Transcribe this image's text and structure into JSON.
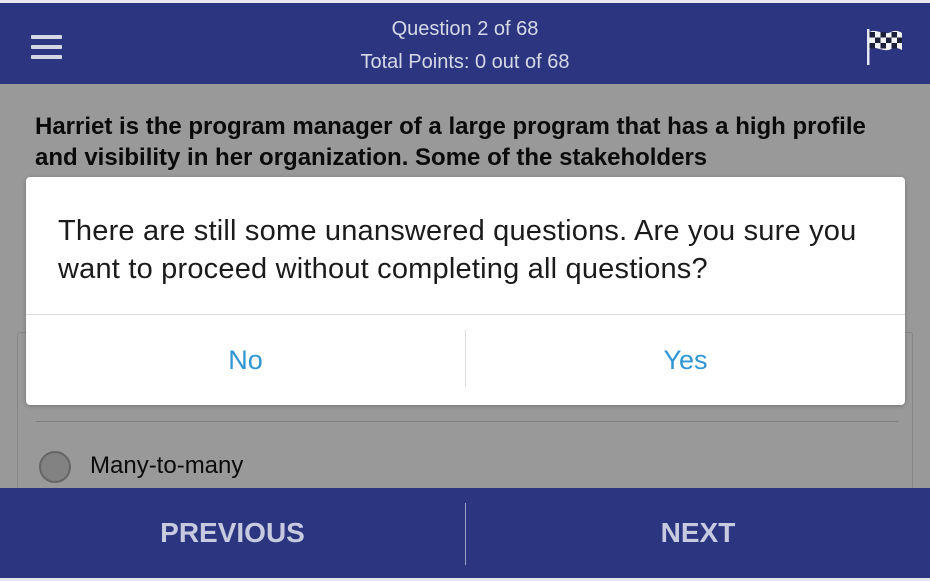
{
  "header": {
    "question_counter": "Question 2 of 68",
    "total_points": "Total Points: 0 out of 68",
    "menu_icon": "hamburger-menu-icon",
    "finish_icon": "checkered-flag-icon"
  },
  "question": {
    "text": "Harriet is the program manager of a large program that has a high profile and visibility in her organization. Some of the stakeholders"
  },
  "options": [
    {
      "label": "Many-to-many",
      "selected": false
    }
  ],
  "dialog": {
    "message": "There are still some unanswered questions. Are you sure you want to proceed without completing all questions?",
    "no_label": "No",
    "yes_label": "Yes"
  },
  "footer": {
    "previous_label": "PREVIOUS",
    "next_label": "NEXT"
  },
  "colors": {
    "header_bg": "#2b3580",
    "footer_bg": "#2b3580",
    "dialog_button_text": "#2f95d3",
    "overlay": "rgba(0,0,0,0.4)"
  }
}
